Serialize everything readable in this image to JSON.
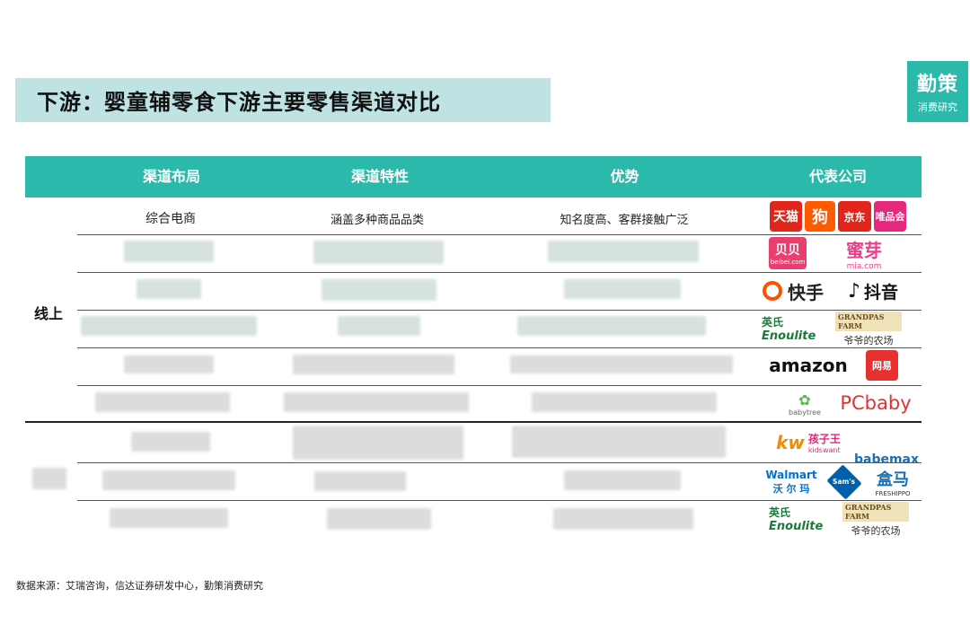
{
  "brand": {
    "name": "勤策",
    "sub": "消费研究",
    "color": "#2bb9ac"
  },
  "title": "下游：婴童辅零食下游主要零售渠道对比",
  "table": {
    "headers": [
      "渠道布局",
      "渠道特性",
      "优势",
      "代表公司"
    ],
    "header_color": "#2bb9ac",
    "groups": [
      {
        "label": "线上",
        "rows": [
          {
            "layout": "综合电商",
            "feature": "涵盖多种商品品类",
            "advantage": "知名度高、客群接触广泛",
            "companies": [
              "天猫",
              "狗",
              "京东",
              "唯品会"
            ]
          },
          {
            "layout": "",
            "feature": "",
            "advantage": "",
            "companies": [
              "贝贝",
              "蜜芽"
            ],
            "companies_sub": [
              "beibei.com",
              "mia.com"
            ]
          },
          {
            "layout": "",
            "feature": "",
            "advantage": "",
            "companies": [
              "快手",
              "抖音"
            ]
          },
          {
            "layout": "",
            "feature": "",
            "advantage": "",
            "companies": [
              "英氏 Enoulite",
              "GRANDPAS FARM 爷爷的农场"
            ]
          },
          {
            "layout": "",
            "feature": "",
            "advantage": "",
            "companies": [
              "amazon",
              "网易"
            ]
          },
          {
            "layout": "",
            "feature": "",
            "advantage": "",
            "companies": [
              "babytree",
              "PCbaby"
            ]
          }
        ]
      },
      {
        "label": "",
        "rows": [
          {
            "layout": "",
            "feature": "",
            "advantage": "",
            "companies": [
              "孩子王 kidswant",
              "babemax"
            ]
          },
          {
            "layout": "",
            "feature": "",
            "advantage": "",
            "companies": [
              "Walmart 沃尔玛",
              "Sam's Club",
              "盒马 FRESHIPPO"
            ]
          },
          {
            "layout": "",
            "feature": "",
            "advantage": "",
            "companies": [
              "英氏 Enoulite",
              "GRANDPAS FARM 爷爷的农场"
            ]
          }
        ]
      }
    ]
  },
  "logos": {
    "tmall": "天猫",
    "gou": "狗",
    "jd": "京东",
    "vip": "唯品会",
    "beibei": "贝贝",
    "beibei_sub": "beibei.com",
    "miya": "蜜芽",
    "miya_sub": "mia.com",
    "kuaishou": "快手",
    "douyin": "抖音",
    "enoulite_cn": "英氏",
    "enoulite_en": "Enoulite",
    "grandpas_en": "GRANDPAS FARM",
    "grandpas_cn": "爷爷的农场",
    "amazon": "amazon",
    "wangyi": "网易",
    "babytree": "babytree",
    "pcbaby": "PCbaby",
    "kidswant_cn": "孩子王",
    "kidswant_en": "kidswant",
    "babemax": "babemax",
    "walmart_en": "Walmart",
    "walmart_cn": "沃 尔 玛",
    "sams": "Sam's",
    "hema": "盒马",
    "hema_en": "FRESHIPPO"
  },
  "footnote": "数据来源：艾瑞咨询，信达证券研发中心，勤策消费研究"
}
